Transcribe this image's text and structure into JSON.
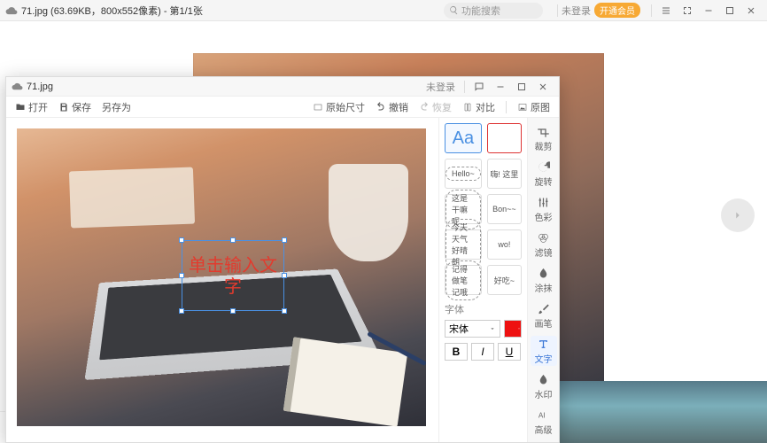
{
  "viewer": {
    "title": "71.jpg (63.69KB，800x552像素) - 第1/1张",
    "search_placeholder": "功能搜索",
    "login_label": "未登录",
    "vip_label": "开通会员"
  },
  "editor": {
    "filename": "71.jpg",
    "login_label": "未登录",
    "toolbar": {
      "open": "打开",
      "save": "保存",
      "save_as": "另存为",
      "orig_size": "原始尺寸",
      "undo": "撤销",
      "redo": "恢复",
      "compare": "对比",
      "original": "原图"
    },
    "text_placeholder": "单击输入文字",
    "tools": {
      "crop": "裁剪",
      "rotate": "旋转",
      "color": "色彩",
      "filter": "滤镜",
      "smudge": "涂抹",
      "brush": "画笔",
      "text": "文字",
      "watermark": "水印",
      "advanced": "高级"
    },
    "text_panel": {
      "aa": "Aa",
      "hello": "Hello~",
      "alt1": "嗨! 这里",
      "alt2": "这是干嘛呢…",
      "bon": "Bon~~",
      "alt3": "今天天气好晴朗",
      "wo": "wo!",
      "alt4": "记得做笔记哦",
      "alt5": "好吃~",
      "font_section": "字体",
      "font_name": "宋体",
      "bold": "B",
      "italic": "I",
      "underline": "U"
    }
  }
}
